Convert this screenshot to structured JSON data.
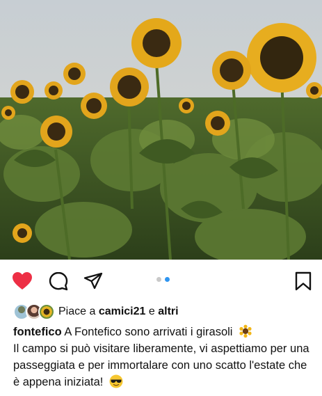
{
  "post": {
    "image_alt": "sunflower-field-photo",
    "carousel": {
      "total": 2,
      "active": 2
    },
    "actions": {
      "like_icon": "heart-filled-icon",
      "comment_icon": "comment-bubble-icon",
      "share_icon": "paper-plane-icon",
      "save_icon": "bookmark-icon"
    },
    "likes": {
      "prefix": "Piace a ",
      "user": "camici21",
      "connector": " e ",
      "others": "altri"
    },
    "caption": {
      "username": "fontefico",
      "line1": " A Fontefico sono arrivati i girasoli ",
      "body": "Il campo si può visitare liberamente, vi aspettiamo per una passeggiata e per immortalare con uno scatto l'estate che è appena iniziata! ",
      "emoji1": "sunflower-emoji",
      "emoji2": "sunglasses-emoji"
    },
    "colors": {
      "like": "#ed2f45",
      "carousel_active": "#2f95f0"
    }
  }
}
